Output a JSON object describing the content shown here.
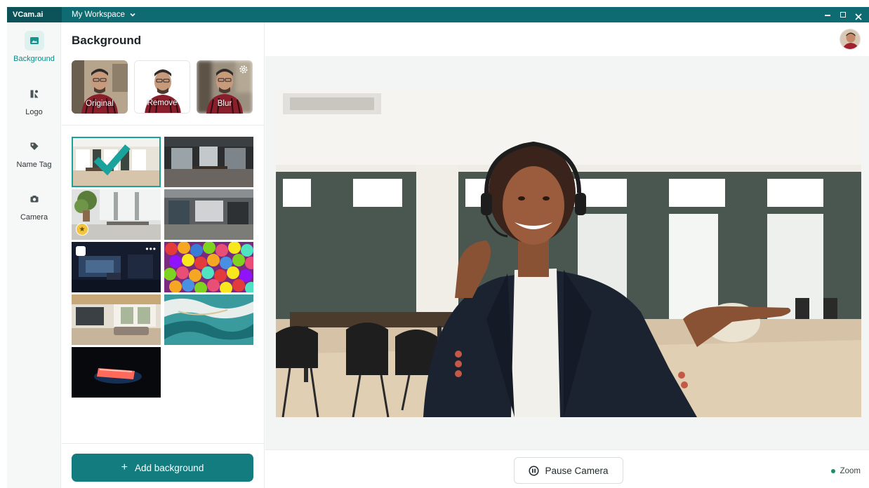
{
  "app": {
    "brand": "VCam.ai",
    "workspace": "My Workspace"
  },
  "nav": {
    "items": [
      {
        "label": "Background",
        "icon": "image-icon",
        "active": true
      },
      {
        "label": "Logo",
        "icon": "logo-icon",
        "active": false
      },
      {
        "label": "Name Tag",
        "icon": "tag-icon",
        "active": false
      },
      {
        "label": "Camera",
        "icon": "camera-icon",
        "active": false
      }
    ]
  },
  "panel": {
    "title": "Background",
    "effects": [
      {
        "label": "Original"
      },
      {
        "label": "Remove"
      },
      {
        "label": "Blur"
      }
    ],
    "thumbnails": [
      {
        "name": "bright-office",
        "selected": true
      },
      {
        "name": "dark-office"
      },
      {
        "name": "plant-office",
        "badge": "star"
      },
      {
        "name": "grey-hallway"
      },
      {
        "name": "night-room",
        "custom": true
      },
      {
        "name": "colorful-balls"
      },
      {
        "name": "living-room"
      },
      {
        "name": "teal-marble"
      },
      {
        "name": "laptop-glow"
      }
    ],
    "add_button": "Add background"
  },
  "stage": {
    "pause_label": "Pause Camera",
    "zoom_label": "Zoom"
  },
  "colors": {
    "brand": "#0f6b72",
    "accent": "#127c7f",
    "selected": "#19a39c"
  }
}
